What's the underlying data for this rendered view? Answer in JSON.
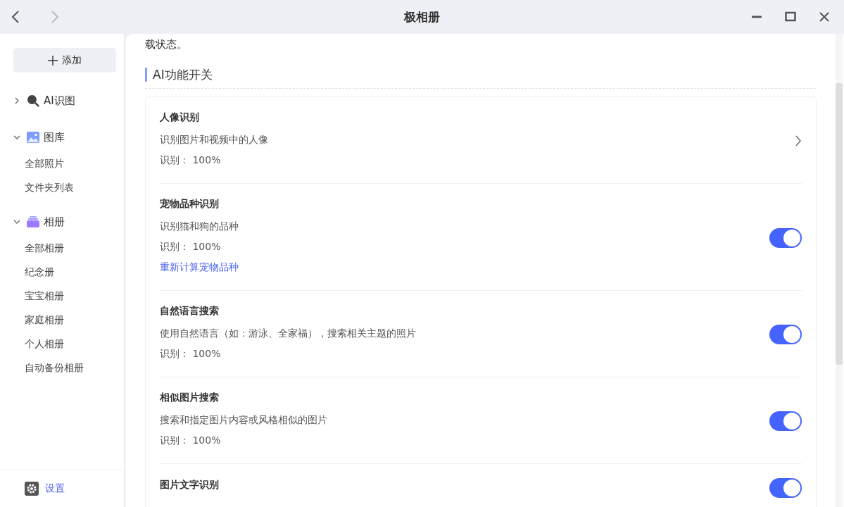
{
  "window": {
    "title": "极相册"
  },
  "sidebar": {
    "add_button": "添加",
    "tree": [
      {
        "label": "AI识图",
        "kind": "search",
        "expanded": false
      },
      {
        "label": "图库",
        "kind": "picture",
        "expanded": true,
        "children": [
          {
            "label": "全部照片"
          },
          {
            "label": "文件夹列表"
          }
        ]
      },
      {
        "label": "相册",
        "kind": "album",
        "expanded": true,
        "children": [
          {
            "label": "全部相册"
          },
          {
            "label": "纪念册"
          },
          {
            "label": "宝宝相册"
          },
          {
            "label": "家庭相册"
          },
          {
            "label": "个人相册"
          },
          {
            "label": "自动备份相册"
          }
        ]
      }
    ],
    "settings": "设置"
  },
  "content": {
    "intro_tail": "载状态。",
    "section_title": "AI功能开关",
    "features": [
      {
        "title": "人像识别",
        "description": "识别图片和视频中的人像",
        "reading": "识别： 100%",
        "kind": "chevron"
      },
      {
        "title": "宠物品种识别",
        "description": "识别猫和狗的品种",
        "reading": "识别： 100%",
        "link": "重新计算宠物品种",
        "kind": "toggle",
        "on": true
      },
      {
        "title": "自然语言搜索",
        "description": "使用自然语言（如：游泳、全家福），搜索相关主题的照片",
        "reading": "识别： 100%",
        "kind": "toggle",
        "on": true
      },
      {
        "title": "相似图片搜索",
        "description": "搜索和指定图片内容或风格相似的图片",
        "reading": "识别： 100%",
        "kind": "toggle",
        "on": true
      },
      {
        "title": "图片文字识别",
        "kind": "toggle",
        "on": true
      }
    ]
  }
}
